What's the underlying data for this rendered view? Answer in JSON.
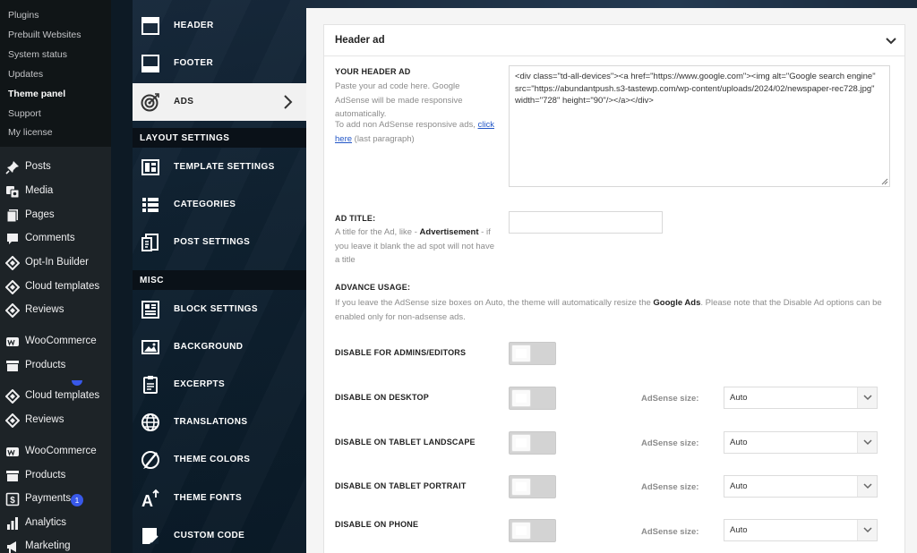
{
  "wp_sidebar": {
    "submenu": [
      "Plugins",
      "Prebuilt Websites",
      "System status",
      "Updates",
      "Theme panel",
      "Support",
      "My license"
    ],
    "submenu_active": "Theme panel",
    "menu": [
      {
        "label": "Posts",
        "icon": "pin-icon"
      },
      {
        "label": "Media",
        "icon": "media-icon"
      },
      {
        "label": "Pages",
        "icon": "pages-icon"
      },
      {
        "label": "Comments",
        "icon": "comment-icon"
      },
      {
        "label": "Opt-In Builder",
        "icon": "diamond-icon"
      },
      {
        "label": "Cloud templates",
        "icon": "diamond-icon"
      },
      {
        "label": "Reviews",
        "icon": "diamond-icon"
      },
      {
        "label": "WooCommerce",
        "icon": "woo-icon"
      },
      {
        "label": "Products",
        "icon": "archive-icon"
      },
      {
        "label": "Cloud templates",
        "icon": "diamond-icon"
      },
      {
        "label": "Reviews",
        "icon": "diamond-icon"
      },
      {
        "label": "WooCommerce",
        "icon": "woo-icon"
      },
      {
        "label": "Products",
        "icon": "archive-icon"
      },
      {
        "label": "Payments",
        "icon": "dollar-icon",
        "badge": "1"
      },
      {
        "label": "Analytics",
        "icon": "bar-chart-icon"
      },
      {
        "label": "Marketing",
        "icon": "megaphone-icon"
      }
    ]
  },
  "panel_nav": {
    "items": [
      {
        "label": "HEADER",
        "icon": "header-layout-icon"
      },
      {
        "label": "FOOTER",
        "icon": "footer-layout-icon"
      },
      {
        "label": "ADS",
        "icon": "target-icon",
        "active": true
      },
      {
        "label": "TEMPLATE SETTINGS",
        "icon": "template-icon"
      },
      {
        "label": "CATEGORIES",
        "icon": "list-icon"
      },
      {
        "label": "POST SETTINGS",
        "icon": "post-settings-icon"
      },
      {
        "label": "BLOCK SETTINGS",
        "icon": "block-icon"
      },
      {
        "label": "BACKGROUND",
        "icon": "image-icon"
      },
      {
        "label": "EXCERPTS",
        "icon": "clipboard-icon"
      },
      {
        "label": "TRANSLATIONS",
        "icon": "globe-icon"
      },
      {
        "label": "THEME COLORS",
        "icon": "brush-icon"
      },
      {
        "label": "THEME FONTS",
        "icon": "font-size-icon"
      },
      {
        "label": "CUSTOM CODE",
        "icon": "code-icon"
      }
    ],
    "sections": [
      "LAYOUT SETTINGS",
      "MISC"
    ]
  },
  "card": {
    "title": "Header ad",
    "ad_code": {
      "label": "YOUR HEADER AD",
      "desc_1": "Paste your ad code here. Google AdSense will be made responsive automatically.",
      "desc_2_prefix": "To add non AdSense responsive ads, ",
      "desc_2_link": "click here",
      "desc_2_suffix": " (last paragraph)",
      "value": "<div class=\"td-all-devices\"><a href=\"https://www.google.com\"><img alt=\"Google search engine\" src=\"https://abundantpush.s3-tastewp.com/wp-content/uploads/2024/02/newspaper-rec728.jpg\" width=\"728\" height=\"90\"/></a></div>"
    },
    "ad_title": {
      "label": "AD TITLE:",
      "desc_prefix": "A title for the Ad, like - ",
      "desc_bold": "Advertisement",
      "desc_suffix": " - if you leave it blank the ad spot will not have a title",
      "value": ""
    },
    "advance": {
      "label": "ADVANCE USAGE:",
      "desc_prefix": "If you leave the AdSense size boxes on Auto, the theme will automatically resize the ",
      "desc_bold": "Google Ads",
      "desc_suffix": ". Please note that the Disable Ad options can be enabled only for non-adsense ads."
    },
    "disable_options": [
      {
        "label": "DISABLE FOR ADMINS/EDITORS",
        "enabled": false
      },
      {
        "label": "DISABLE ON DESKTOP",
        "enabled": false,
        "size_label": "AdSense size:",
        "size_value": "Auto"
      },
      {
        "label": "DISABLE ON TABLET LANDSCAPE",
        "enabled": false,
        "size_label": "AdSense size:",
        "size_value": "Auto"
      },
      {
        "label": "DISABLE ON TABLET PORTRAIT",
        "enabled": false,
        "size_label": "AdSense size:",
        "size_value": "Auto"
      },
      {
        "label": "DISABLE ON PHONE",
        "enabled": false,
        "size_label": "AdSense size:",
        "size_value": "Auto"
      }
    ]
  },
  "colors": {
    "wp_sidebar": "#1d2327",
    "wp_submenu": "#101517",
    "panel_nav": "#0f2130",
    "active_nav": "#f1f1f1",
    "badge": "#3858e9",
    "link": "#2256c7"
  }
}
